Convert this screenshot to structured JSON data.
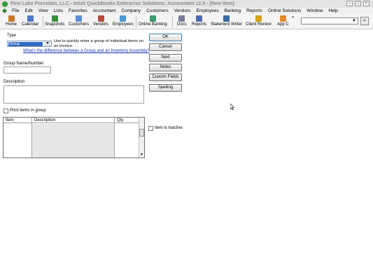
{
  "window": {
    "title": "Pine Lake Porcelain, LLC  -  Intuit QuickBooks Enterprise Solutions: Accountant 12.0 - [New Item]",
    "controls": [
      "–",
      "□",
      "×"
    ]
  },
  "menu": [
    "File",
    "Edit",
    "View",
    "Lists",
    "Favorites",
    "Accountant",
    "Company",
    "Customers",
    "Vendors",
    "Employees",
    "Banking",
    "Reports",
    "Online Solutions",
    "Window",
    "Help"
  ],
  "toolbar": {
    "items": [
      {
        "label": "Home",
        "icon": "home-icon",
        "color": "#c9772b"
      },
      {
        "label": "Calendar",
        "icon": "calendar-icon",
        "color": "#4a78c2"
      },
      {
        "label": "Snapshots",
        "icon": "snapshots-icon",
        "color": "#3a8f3a"
      },
      {
        "label": "Customers",
        "icon": "customers-icon",
        "color": "#5b8ed6"
      },
      {
        "label": "Vendors",
        "icon": "vendors-icon",
        "color": "#b54a3a"
      },
      {
        "label": "Employees",
        "icon": "employees-icon",
        "color": "#4a9ad0"
      },
      {
        "label": "Online Banking",
        "icon": "online-banking-icon",
        "color": "#3a9a6a"
      },
      {
        "label": "Docs",
        "icon": "docs-icon",
        "color": "#7a7a9a"
      },
      {
        "label": "Reports",
        "icon": "reports-icon",
        "color": "#4a6ab0"
      },
      {
        "label": "Statement Writer",
        "icon": "statement-writer-icon",
        "color": "#3a6aa0"
      },
      {
        "label": "Client Review",
        "icon": "client-review-icon",
        "color": "#d9a21a"
      },
      {
        "label": "App C",
        "icon": "app-center-icon",
        "color": "#e08a2a"
      }
    ],
    "overflow": "»"
  },
  "form": {
    "type_label": "Type",
    "type_value": "Group",
    "type_help": "Use to quickly enter a group of individual items on an invoice.",
    "type_link": "What's the difference between a Group and an Inventory Assembly?",
    "name_label": "Group Name/Number",
    "name_value": "",
    "description_label": "Description",
    "description_value": "",
    "print_items_label": "Print items in group",
    "item_inactive_label": "Item is inactive",
    "grid_columns": [
      "Item",
      "Description",
      "Qty"
    ]
  },
  "buttons": {
    "ok": "OK",
    "cancel": "Cancel",
    "next": "Next",
    "notes": "Notes",
    "custom_fields": "Custom Fields",
    "spelling": "Spelling"
  }
}
